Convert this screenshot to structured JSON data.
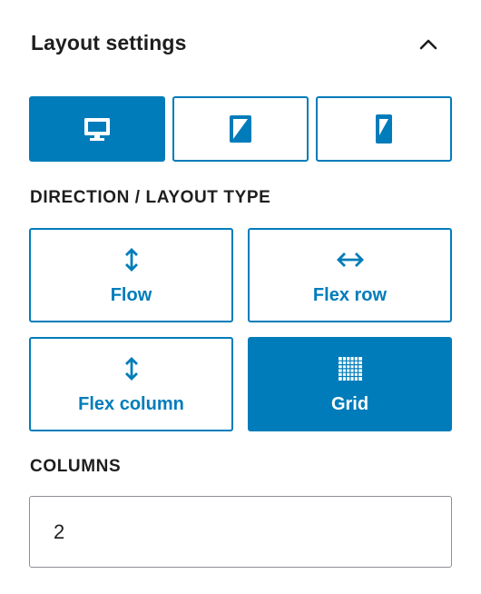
{
  "panel": {
    "title": "Layout settings",
    "collapse_icon": "chevron-up-icon"
  },
  "devices": [
    {
      "name": "desktop",
      "icon": "desktop-icon",
      "active": true
    },
    {
      "name": "tablet",
      "icon": "tablet-icon",
      "active": false
    },
    {
      "name": "mobile",
      "icon": "mobile-icon",
      "active": false
    }
  ],
  "direction": {
    "label": "DIRECTION / LAYOUT TYPE",
    "options": [
      {
        "label": "Flow",
        "icon": "vertical-arrows-icon",
        "active": false
      },
      {
        "label": "Flex row",
        "icon": "horizontal-arrows-icon",
        "active": false
      },
      {
        "label": "Flex column",
        "icon": "vertical-arrows-icon",
        "active": false
      },
      {
        "label": "Grid",
        "icon": "grid-icon",
        "active": true
      }
    ]
  },
  "columns": {
    "label": "COLUMNS",
    "value": "2"
  },
  "colors": {
    "accent": "#007cba",
    "text": "#1e1e1e",
    "border": "#8c8f94"
  }
}
